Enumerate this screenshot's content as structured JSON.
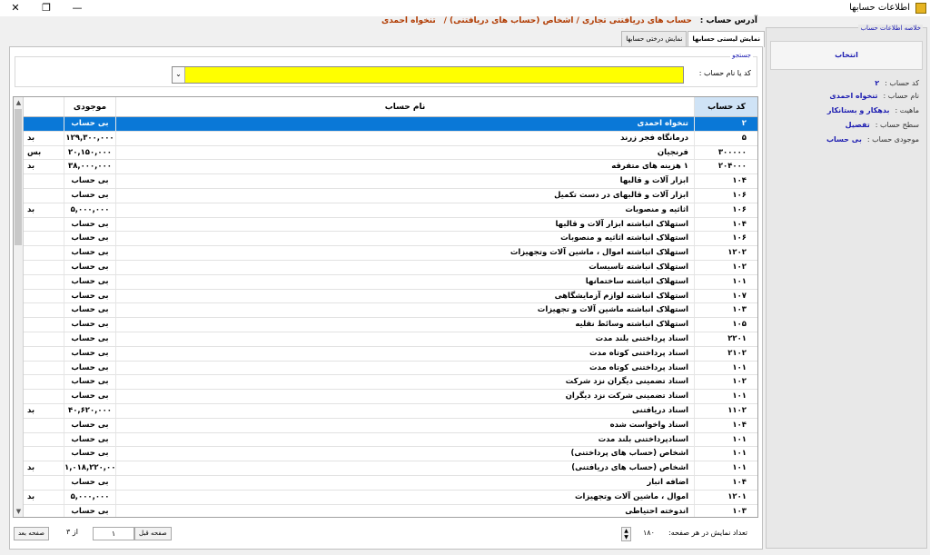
{
  "window": {
    "title": "اطلاعات حسابها",
    "controls": {
      "minimize": "—",
      "restore": "❐",
      "close": "✕"
    }
  },
  "address": {
    "label": "آدرس حساب :",
    "path": "حساب های دریافتنی تجاری / اشخاص (حساب های دریافتنی) /",
    "current": "تنخواه احمدی"
  },
  "tabs": [
    {
      "label": "نمایش لیستی حسابها",
      "active": true
    },
    {
      "label": "نمایش درختی حسابها",
      "active": false
    }
  ],
  "search": {
    "group_title": "جستجو",
    "field_label": "کد یا نام حساب :",
    "value": ""
  },
  "grid": {
    "headers": {
      "code": "کد حساب",
      "name": "نام حساب",
      "balance": "موجودی",
      "flag": ""
    },
    "rows": [
      {
        "code": "۲",
        "name": "تنخواه احمدی",
        "balance": "بی حساب",
        "flag": ""
      },
      {
        "code": "۵",
        "name": "درمانگاه فجر زرند",
        "balance": "۱۲۹,۳۰۰,۰۰۰",
        "flag": "بد"
      },
      {
        "code": "۳۰۰۰۰۰",
        "name": "فرنجیان",
        "balance": "۲۰,۱۵۰,۰۰۰",
        "flag": "بس"
      },
      {
        "code": "۲۰۴۰۰۰",
        "name": "۱ هزینه های متفرقه",
        "balance": "۳۸,۰۰۰,۰۰۰",
        "flag": "بد"
      },
      {
        "code": "۱۰۴",
        "name": "ابزار آلات و قالبها",
        "balance": "بی حساب",
        "flag": ""
      },
      {
        "code": "۱۰۶",
        "name": "ابزار آلات و قالبهای در دست تکمیل",
        "balance": "بی حساب",
        "flag": ""
      },
      {
        "code": "۱۰۶",
        "name": "اثاثیه و منصوبات",
        "balance": "۵,۰۰۰,۰۰۰",
        "flag": "بد"
      },
      {
        "code": "۱۰۴",
        "name": "استهلاک انباشته ابزار آلات و قالبها",
        "balance": "بی حساب",
        "flag": ""
      },
      {
        "code": "۱۰۶",
        "name": "استهلاک انباشته اثاثیه و منصوبات",
        "balance": "بی حساب",
        "flag": ""
      },
      {
        "code": "۱۲۰۲",
        "name": "استهلاک انباشته اموال ، ماشین آلات وتجهیزات",
        "balance": "بی حساب",
        "flag": ""
      },
      {
        "code": "۱۰۲",
        "name": "استهلاک انباشته تاسیسات",
        "balance": "بی حساب",
        "flag": ""
      },
      {
        "code": "۱۰۱",
        "name": "استهلاک انباشته ساختمانها",
        "balance": "بی حساب",
        "flag": ""
      },
      {
        "code": "۱۰۷",
        "name": "استهلاک انباشته لوازم آزمایشگاهی",
        "balance": "بی حساب",
        "flag": ""
      },
      {
        "code": "۱۰۳",
        "name": "استهلاک انباشته ماشین آلات و تجهیزات",
        "balance": "بی حساب",
        "flag": ""
      },
      {
        "code": "۱۰۵",
        "name": "استهلاک انباشته وسائط نقلیه",
        "balance": "بی حساب",
        "flag": ""
      },
      {
        "code": "۲۲۰۱",
        "name": "اسناد پرداختنی بلند مدت",
        "balance": "بی حساب",
        "flag": ""
      },
      {
        "code": "۲۱۰۲",
        "name": "اسناد پرداختنی کوتاه مدت",
        "balance": "بی حساب",
        "flag": ""
      },
      {
        "code": "۱۰۱",
        "name": "اسناد پرداختنی کوتاه مدت",
        "balance": "بی حساب",
        "flag": ""
      },
      {
        "code": "۱۰۲",
        "name": "اسناد تضمینی دیگران نزد شرکت",
        "balance": "بی حساب",
        "flag": ""
      },
      {
        "code": "۱۰۱",
        "name": "اسناد تضمینی شرکت نزد دیگران",
        "balance": "بی حساب",
        "flag": ""
      },
      {
        "code": "۱۱۰۲",
        "name": "اسناد دریافتنی",
        "balance": "۴۰,۶۲۰,۰۰۰",
        "flag": "بد"
      },
      {
        "code": "۱۰۴",
        "name": "اسناد واخواست شده",
        "balance": "بی حساب",
        "flag": ""
      },
      {
        "code": "۱۰۱",
        "name": "اسنادپرداختنی بلند مدت",
        "balance": "بی حساب",
        "flag": ""
      },
      {
        "code": "۱۰۱",
        "name": "اشخاص (حساب های پرداختنی)",
        "balance": "بی حساب",
        "flag": ""
      },
      {
        "code": "۱۰۱",
        "name": "اشخاص (حساب های دریافتنی)",
        "balance": "۱,۰۱۸,۲۲۰,۰۰۰",
        "flag": "بد"
      },
      {
        "code": "۱۰۴",
        "name": "اضافه انبار",
        "balance": "بی حساب",
        "flag": ""
      },
      {
        "code": "۱۲۰۱",
        "name": "اموال ، ماشین آلات وتجهیزات",
        "balance": "۵,۰۰۰,۰۰۰",
        "flag": "بد"
      },
      {
        "code": "۱۰۳",
        "name": "اندوخته احتیاطی",
        "balance": "بی حساب",
        "flag": ""
      }
    ]
  },
  "pager": {
    "next_label": "صفحه بعد",
    "prev_label": "صفحه قبل",
    "of_text": "از ۳",
    "current_page": "۱",
    "per_page_label": "تعداد نمایش در هر صفحه:",
    "per_page_value": "۱۸۰"
  },
  "summary": {
    "title": "خلاصه اطلاعات حساب",
    "select_button": "انتخاب",
    "fields": [
      {
        "label": "کد حساب :",
        "value": "۲"
      },
      {
        "label": "نام حساب :",
        "value": "تنخواه احمدی"
      },
      {
        "label": "ماهیت :",
        "value": "بدهکار و بستانکار"
      },
      {
        "label": "سطح حساب :",
        "value": "تفصیل"
      },
      {
        "label": "موجودی حساب :",
        "value": "بی حساب"
      }
    ]
  }
}
